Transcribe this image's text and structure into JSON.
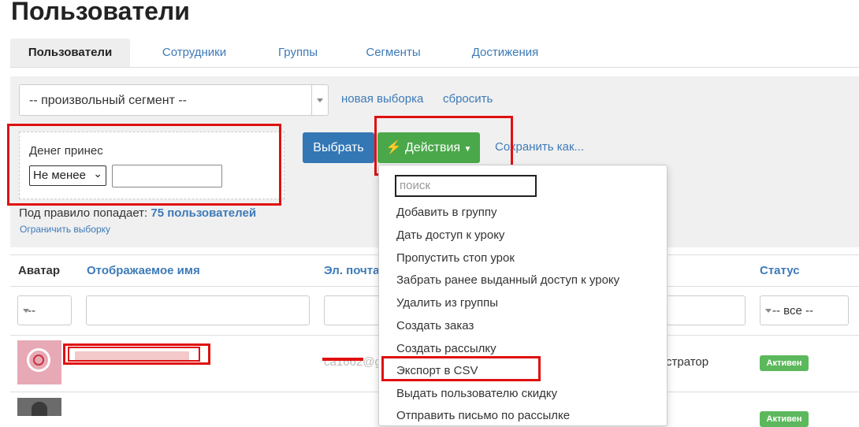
{
  "page_title": "Пользователи",
  "tabs": [
    {
      "label": "Пользователи",
      "active": true
    },
    {
      "label": "Сотрудники"
    },
    {
      "label": "Группы"
    },
    {
      "label": "Сегменты"
    },
    {
      "label": "Достижения"
    }
  ],
  "segment": {
    "selected": "-- произвольный сегмент --",
    "new_selection": "новая выборка",
    "reset": "сбросить"
  },
  "filter": {
    "label": "Денег принес",
    "operator": "Не менее",
    "value": ""
  },
  "buttons": {
    "choose": "Выбрать",
    "actions": "Действия",
    "save_as": "Сохранить как..."
  },
  "rule": {
    "prefix": "Под правило попадает:",
    "count": "75 пользователей",
    "limit": "Ограничить выборку"
  },
  "actions_menu": {
    "search_placeholder": "поиск",
    "items": [
      "Добавить в группу",
      "Дать доступ к уроку",
      "Пропустить стоп урок",
      "Забрать ранее выданный доступ к уроку",
      "Удалить из группы",
      "Создать заказ",
      "Создать рассылку",
      "Экспорт в CSV",
      "Выдать пользователю скидку",
      "Отправить письмо по рассылке"
    ]
  },
  "table": {
    "headers": {
      "avatar": "Аватар",
      "name": "Отображаемое имя",
      "email": "Эл. почта",
      "status": "Статус"
    },
    "filters": {
      "avatar": "--",
      "status": "-- все --"
    },
    "rows": [
      {
        "role": "стратор",
        "status": "Активен",
        "email_fragment": "ca1662@g"
      },
      {
        "status": "Активен"
      }
    ]
  },
  "colors": {
    "link": "#3d7ab8",
    "primary_button": "#3377b5",
    "success_button": "#4aa84a",
    "annotation_red": "#e01010",
    "status_badge": "#5cb85c"
  }
}
